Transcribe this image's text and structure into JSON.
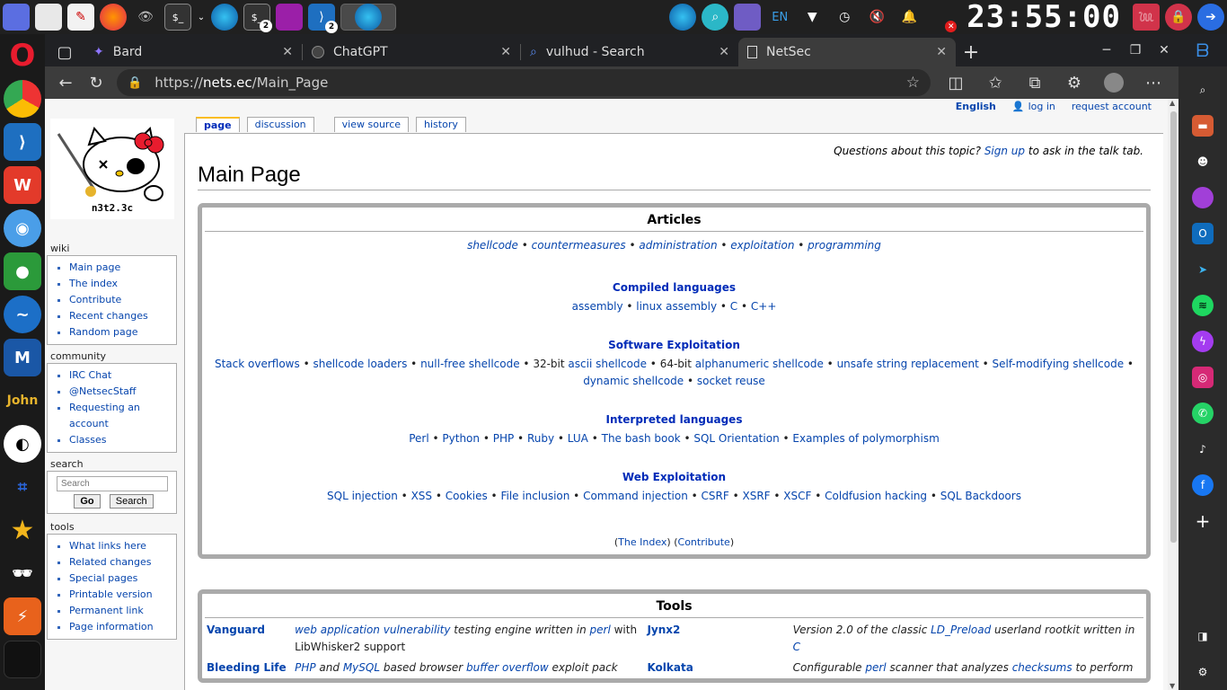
{
  "taskbar": {
    "clock": "23:55:00",
    "lang": "EN",
    "badge_terminal": "2",
    "badge_vscode": "2"
  },
  "tabs": [
    {
      "title": "Bard",
      "icon": "bard-icon"
    },
    {
      "title": "ChatGPT",
      "icon": "chatgpt-icon"
    },
    {
      "title": "vulhud - Search",
      "icon": "search-icon"
    },
    {
      "title": "NetSec",
      "icon": "page-icon"
    }
  ],
  "address": {
    "scheme": "https://",
    "host": "nets.ec",
    "path": "/Main_Page"
  },
  "logo_text": "n3t2.3c",
  "personal": {
    "lang": "English",
    "login": "log in",
    "request": "request account"
  },
  "page_tabs": [
    "page",
    "discussion",
    "view source",
    "history"
  ],
  "sidebar": {
    "wiki": {
      "title": "wiki",
      "items": [
        "Main page",
        "The index",
        "Contribute",
        "Recent changes",
        "Random page"
      ]
    },
    "community": {
      "title": "community",
      "items": [
        "IRC Chat",
        "@NetsecStaff",
        "Requesting an account",
        "Classes"
      ]
    },
    "search": {
      "title": "search",
      "placeholder": "Search",
      "go": "Go",
      "search": "Search"
    },
    "tools": {
      "title": "tools",
      "items": [
        "What links here",
        "Related changes",
        "Special pages",
        "Printable version",
        "Permanent link",
        "Page information"
      ]
    }
  },
  "notice": {
    "pre": "Questions about this topic?",
    "link": "Sign up",
    "post": "to ask in the talk tab."
  },
  "heading": "Main Page",
  "articles": {
    "title": "Articles",
    "top": [
      "shellcode",
      "countermeasures",
      "administration",
      "exploitation",
      "programming"
    ],
    "compiled": {
      "title": "Compiled languages",
      "items": [
        "assembly",
        "linux assembly",
        "C",
        "C++"
      ]
    },
    "software": {
      "title": "Software Exploitation",
      "items": [
        "Stack overflows",
        "shellcode loaders",
        "null-free shellcode",
        "32-bit",
        "ascii shellcode",
        "64-bit",
        "alphanumeric shellcode",
        "unsafe string replacement",
        "Self-modifying shellcode",
        "dynamic shellcode",
        "socket reuse"
      ]
    },
    "interpreted": {
      "title": "Interpreted languages",
      "items": [
        "Perl",
        "Python",
        "PHP",
        "Ruby",
        "LUA",
        "The bash book",
        "SQL Orientation",
        "Examples of polymorphism"
      ]
    },
    "web": {
      "title": "Web Exploitation",
      "items": [
        "SQL injection",
        "XSS",
        "Cookies",
        "File inclusion",
        "Command injection",
        "CSRF",
        "XSRF",
        "XSCF",
        "Coldfusion hacking",
        "SQL Backdoors"
      ]
    },
    "footer": {
      "index": "The Index",
      "contribute": "Contribute"
    }
  },
  "tools": {
    "title": "Tools",
    "rows": [
      {
        "name1": "Vanguard",
        "desc1": [
          "web application vulnerability",
          " testing engine written in ",
          "perl",
          " with LibWhisker2 support"
        ],
        "name2": "Jynx2",
        "desc2": [
          "Version 2.0 of the classic ",
          "LD_Preload",
          " userland rootkit written in ",
          "C"
        ]
      },
      {
        "name1": "Bleeding Life",
        "desc1": [
          "PHP",
          " and ",
          "MySQL",
          " based browser ",
          "buffer overflow",
          " exploit pack"
        ],
        "name2": "Kolkata",
        "desc2": [
          "Configurable ",
          "perl",
          " scanner that analyzes ",
          "checksums",
          " to perform"
        ]
      }
    ]
  },
  "colors": {
    "link": "#0645ad",
    "tab_active": "#3c3c3c",
    "box_border": "#aaaaaa"
  }
}
